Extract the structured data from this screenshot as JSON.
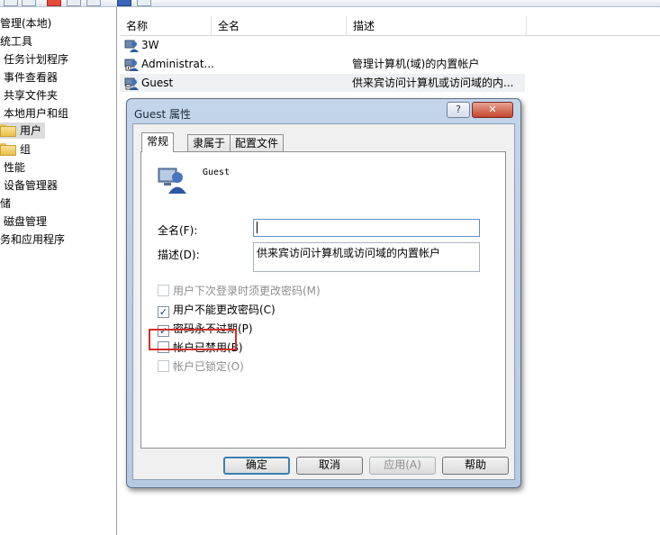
{
  "tree": {
    "items": [
      {
        "label": "管理(本地)"
      },
      {
        "label": "统工具"
      },
      {
        "label": "任务计划程序"
      },
      {
        "label": "事件查看器"
      },
      {
        "label": "共享文件夹"
      },
      {
        "label": "本地用户和组"
      },
      {
        "label": "用户"
      },
      {
        "label": "组"
      },
      {
        "label": "性能"
      },
      {
        "label": "设备管理器"
      },
      {
        "label": "储"
      },
      {
        "label": "磁盘管理"
      },
      {
        "label": "务和应用程序"
      }
    ]
  },
  "list": {
    "columns": [
      "名称",
      "全名",
      "描述"
    ],
    "rows": [
      {
        "name": "3W",
        "fullname": "",
        "description": ""
      },
      {
        "name": "Administrat...",
        "fullname": "",
        "description": "管理计算机(域)的内置帐户"
      },
      {
        "name": "Guest",
        "fullname": "",
        "description": "供来宾访问计算机或访问域的内..."
      }
    ]
  },
  "dialog": {
    "title": "Guest 属性",
    "help_glyph": "?",
    "close_glyph": "✕",
    "tabs": [
      "常规",
      "隶属于",
      "配置文件"
    ],
    "username": "Guest",
    "fullname_label": "全名(F):",
    "fullname_value": "",
    "description_label": "描述(D):",
    "description_value": "供来宾访问计算机或访问域的内置帐户",
    "checkboxes": [
      {
        "label": "用户下次登录时须更改密码(M)",
        "checked": false,
        "disabled": true
      },
      {
        "label": "用户不能更改密码(C)",
        "checked": true,
        "disabled": false
      },
      {
        "label": "密码永不过期(P)",
        "checked": true,
        "disabled": false
      },
      {
        "label": "帐户已禁用(B)",
        "checked": false,
        "disabled": false
      },
      {
        "label": "帐户已锁定(O)",
        "checked": false,
        "disabled": true
      }
    ],
    "buttons": {
      "ok": "确定",
      "cancel": "取消",
      "apply": "应用(A)",
      "help": "帮助"
    }
  },
  "colors": {
    "highlight": "#d0302a",
    "dialog_frame": "#b6cae2"
  },
  "icons": [
    "user-icon",
    "folder-icon",
    "help-icon",
    "close-icon",
    "checkmark-icon"
  ]
}
